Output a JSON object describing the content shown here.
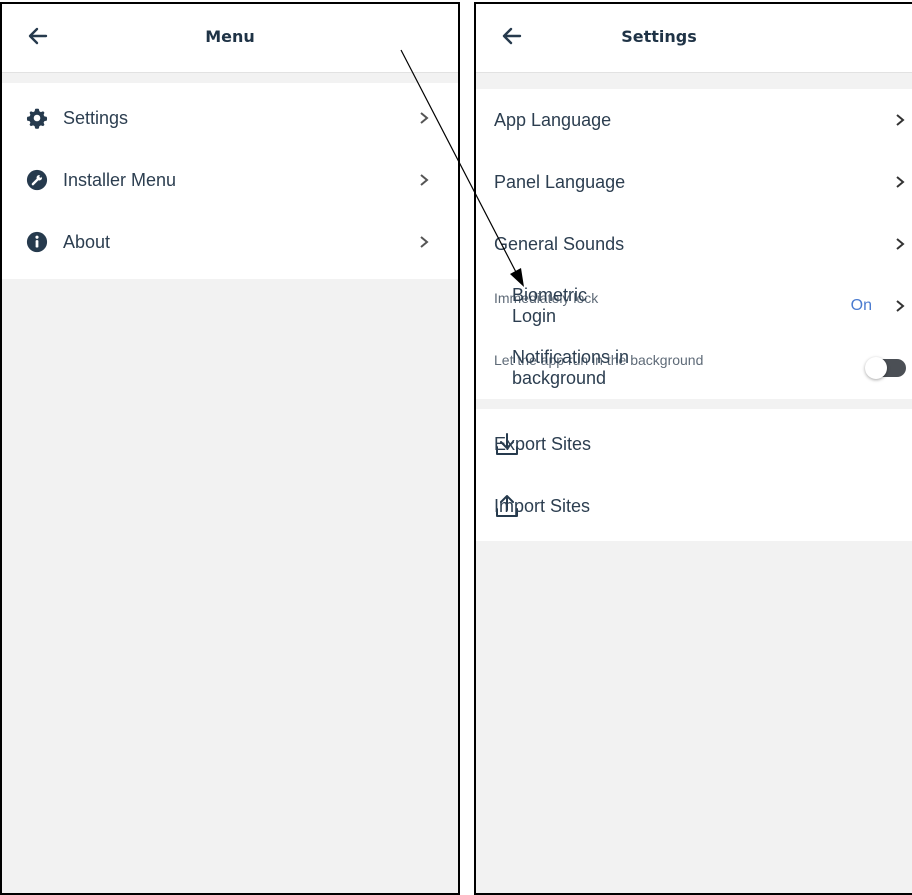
{
  "left_screen": {
    "title": "Menu",
    "items": [
      {
        "label": "Settings",
        "icon": "gear-icon"
      },
      {
        "label": "Installer Menu",
        "icon": "wrench-icon"
      },
      {
        "label": "About",
        "icon": "info-icon"
      }
    ]
  },
  "right_screen": {
    "title": "Settings",
    "items": [
      {
        "label": "App Language"
      },
      {
        "label": "Panel Language"
      },
      {
        "label": "General Sounds"
      }
    ],
    "biometric": {
      "label": "Biometric Login",
      "sub": "Immediately lock",
      "value": "On"
    },
    "notifications": {
      "label": "Notifications in background",
      "sub": "Let the app run in the background",
      "enabled": false
    },
    "actions": [
      {
        "label": "Export Sites",
        "icon": "download-icon"
      },
      {
        "label": "Import Sites",
        "icon": "upload-icon"
      }
    ]
  },
  "colors": {
    "accent": "#4a7bd0",
    "text": "#2c3e50",
    "background": "#f2f2f2",
    "toggle_off": "#4b4f55"
  }
}
